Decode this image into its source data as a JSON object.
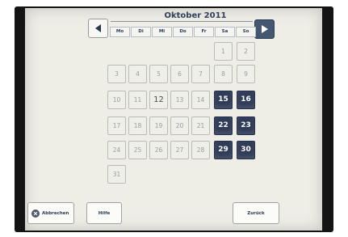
{
  "calendar": {
    "title": "Oktober 2011",
    "weekdays": [
      "Mo",
      "Di",
      "Mi",
      "Do",
      "Fr",
      "Sa",
      "So"
    ],
    "selected_weekend_days": [
      "15",
      "16",
      "22",
      "23",
      "29",
      "30"
    ],
    "today": "12"
  },
  "icons": {
    "prev": "triangle-left-icon",
    "next": "triangle-right-icon",
    "cancel": "x-circle-icon"
  },
  "buttons": {
    "cancel": "Abbrechen",
    "help": "Hilfe",
    "back": "Zurück"
  },
  "colors": {
    "selected_day": "#2f3b57",
    "title_text": "#33405c",
    "screen_bg": "#eeede6"
  }
}
